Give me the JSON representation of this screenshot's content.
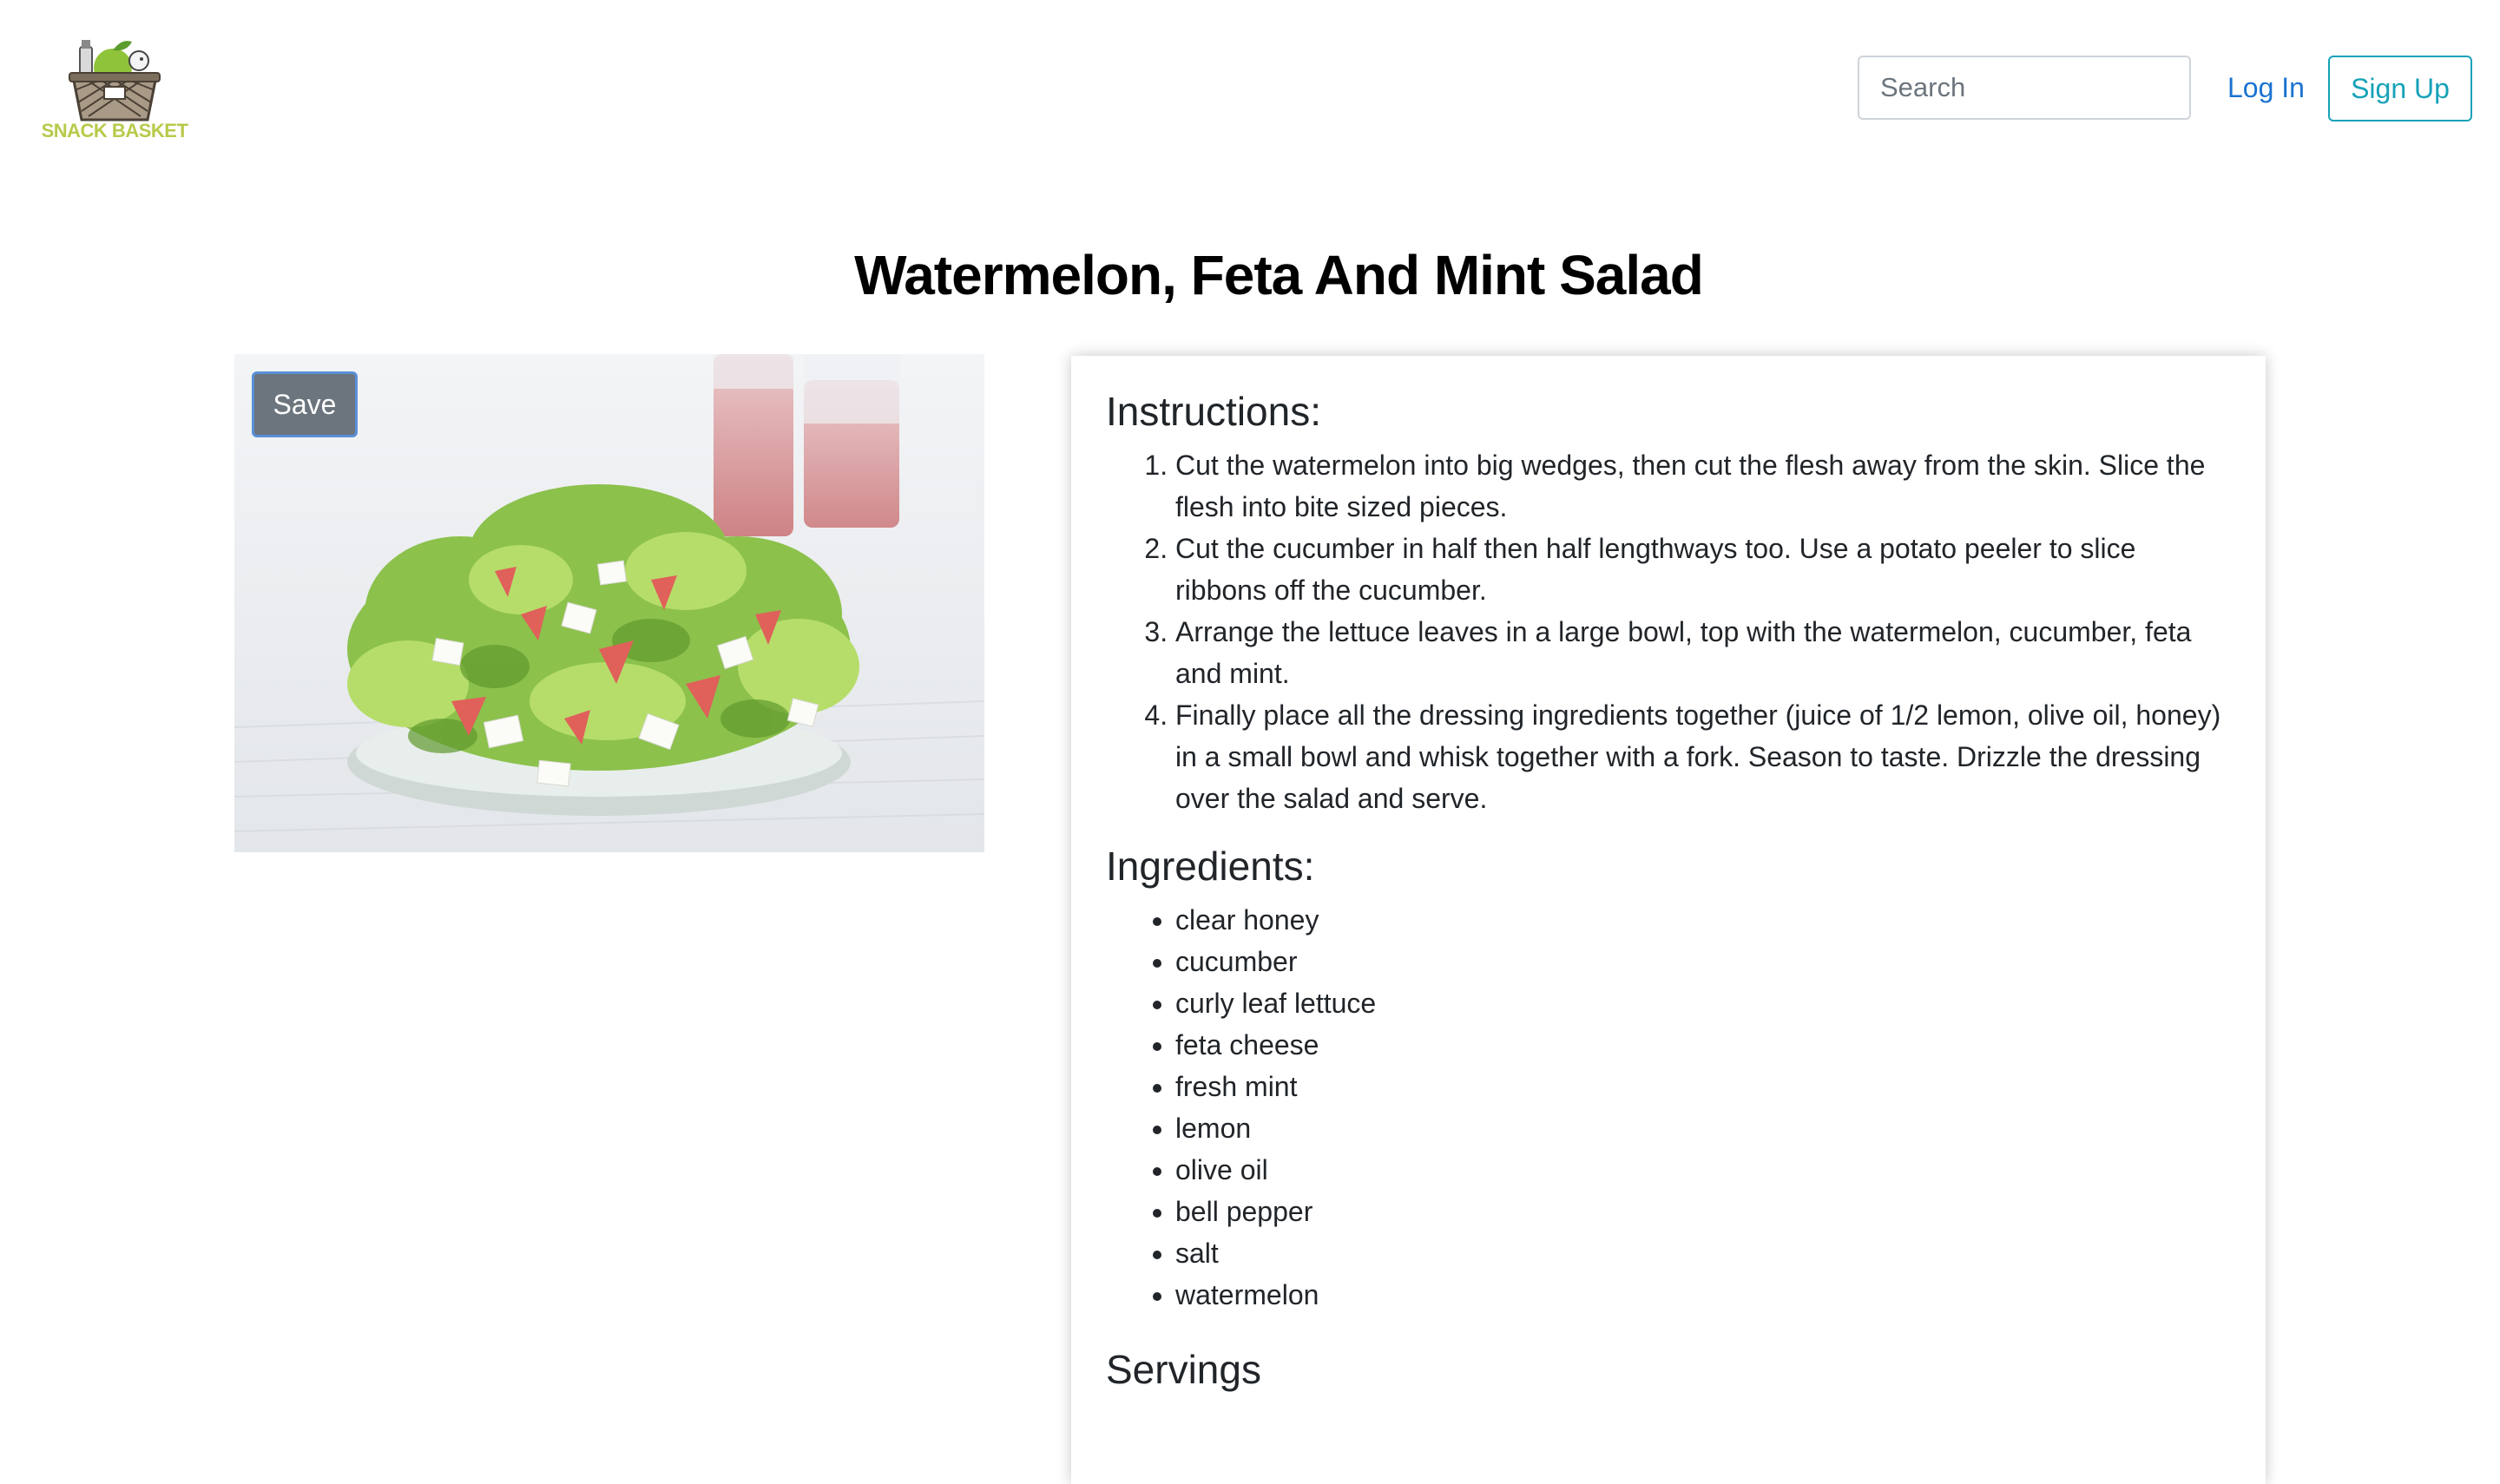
{
  "header": {
    "logo_text": "SNACK BASKET",
    "search_placeholder": "Search",
    "login_label": "Log In",
    "signup_label": "Sign Up"
  },
  "recipe": {
    "title": "Watermelon, Feta And Mint Salad",
    "save_label": "Save",
    "instructions_heading": "Instructions:",
    "instructions": [
      "Cut the watermelon into big wedges, then cut the flesh away from the skin. Slice the flesh into bite sized pieces.",
      "Cut the cucumber in half then half lengthways too. Use a potato peeler to slice ribbons off the cucumber.",
      "Arrange the lettuce leaves in a large bowl, top with the watermelon, cucumber, feta and mint.",
      "Finally place all the dressing ingredients together (juice of 1/2 lemon, olive oil, honey) in a small bowl and whisk together with a fork. Season to taste. Drizzle the dressing over the salad and serve."
    ],
    "ingredients_heading": "Ingredients:",
    "ingredients": [
      "clear honey",
      "cucumber",
      "curly leaf lettuce",
      "feta cheese",
      "fresh mint",
      "lemon",
      "olive oil",
      "bell pepper",
      "salt",
      "watermelon"
    ],
    "servings_heading": "Servings"
  },
  "colors": {
    "link": "#1b73d1",
    "signup_accent": "#17a2b8",
    "save_bg": "#6c757d",
    "logo_green": "#b9c94a"
  }
}
